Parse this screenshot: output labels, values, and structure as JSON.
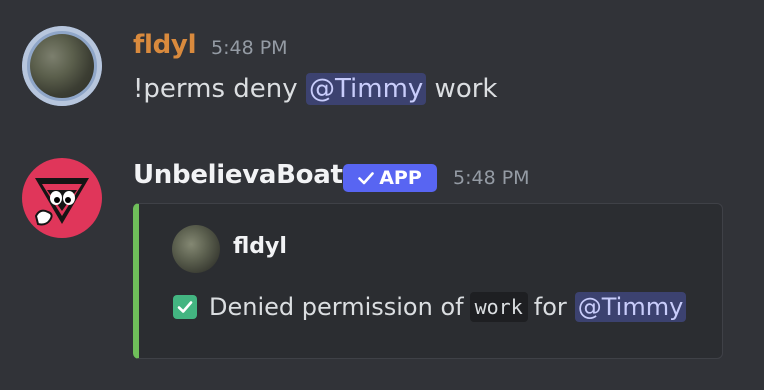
{
  "messages": [
    {
      "author": "fldyl",
      "author_color": "#d98a3d",
      "time": "5:48 PM",
      "content": {
        "prefix": "!perms deny ",
        "mention": "@Timmy",
        "suffix": " work"
      }
    },
    {
      "author": "UnbelievaBoat",
      "author_color": "#f2f3f5",
      "badge": "APP",
      "time": "5:48 PM",
      "embed": {
        "author": "fldyl",
        "accent_color": "#6fbf5a",
        "desc_prefix": "Denied permission of",
        "code": "work",
        "desc_mid": "for",
        "mention": "@Timmy"
      }
    }
  ]
}
